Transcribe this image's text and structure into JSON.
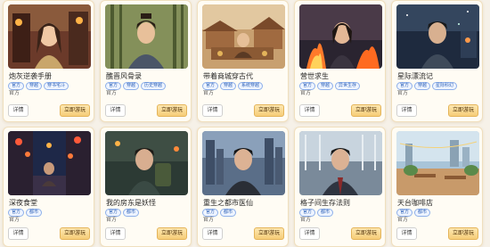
{
  "colors": {
    "page_bg": "#f6f1e8",
    "card_bg": "#fffcf4",
    "tag_text": "#2e62b8",
    "play_button": "#f6cd78"
  },
  "cards": [
    {
      "title": "炮灰逆袭手册",
      "tags": [
        "官方",
        "穿越",
        "穿书宅斗"
      ],
      "source": "官方",
      "detail_label": "详情",
      "play_label": "立即游玩",
      "image": "portrait-young-woman-icon"
    },
    {
      "title": "醮晋风骨录",
      "tags": [
        "官方",
        "穿越",
        "历史穿越"
      ],
      "source": "官方",
      "detail_label": "详情",
      "play_label": "立即游玩",
      "image": "portrait-scholar-man-icon"
    },
    {
      "title": "带着商城穿古代",
      "tags": [
        "官方",
        "穿越",
        "系统穿越"
      ],
      "source": "官方",
      "detail_label": "详情",
      "play_label": "立即游玩",
      "image": "ancient-market-icon"
    },
    {
      "title": "营世求生",
      "tags": [
        "官方",
        "穿越",
        "异世生存"
      ],
      "source": "官方",
      "detail_label": "详情",
      "play_label": "立即游玩",
      "image": "portrait-survivor-fire-icon"
    },
    {
      "title": "星际漂流记",
      "tags": [
        "官方",
        "穿越",
        "星际科幻"
      ],
      "source": "官方",
      "detail_label": "详情",
      "play_label": "立即游玩",
      "image": "portrait-space-pilot-icon"
    },
    {
      "title": "深夜食堂",
      "tags": [
        "官方",
        "都市"
      ],
      "source": "官方",
      "detail_label": "详情",
      "play_label": "立即游玩",
      "image": "night-street-lanterns-icon"
    },
    {
      "title": "我的房东是妖怪",
      "tags": [
        "官方",
        "都市"
      ],
      "source": "官方",
      "detail_label": "详情",
      "play_label": "立即游玩",
      "image": "portrait-backpack-man-icon"
    },
    {
      "title": "重生之都市医仙",
      "tags": [
        "官方",
        "都市"
      ],
      "source": "官方",
      "detail_label": "详情",
      "play_label": "立即游玩",
      "image": "portrait-city-doctor-icon"
    },
    {
      "title": "格子间生存法则",
      "tags": [
        "官方",
        "都市"
      ],
      "source": "官方",
      "detail_label": "详情",
      "play_label": "立即游玩",
      "image": "portrait-office-man-icon"
    },
    {
      "title": "天台咖啡店",
      "tags": [
        "官方",
        "都市"
      ],
      "source": "官方",
      "detail_label": "详情",
      "play_label": "立即游玩",
      "image": "rooftop-cafe-icon"
    }
  ]
}
